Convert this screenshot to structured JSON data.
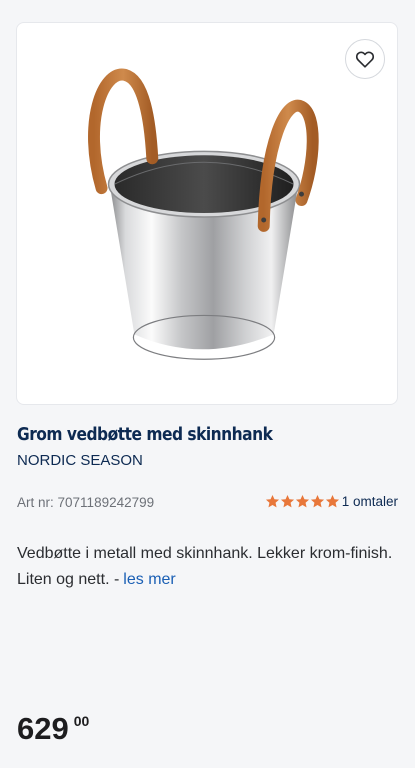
{
  "product": {
    "title": "Grom vedbøtte med skinnhank",
    "brand": "NORDIC SEASON",
    "image_alt": "vedbøtte",
    "favorite_icon": "heart-outline-icon"
  },
  "meta": {
    "art_label": "Art nr:",
    "art_number": "7071189242799",
    "rating_stars": 5,
    "rating_max": 5,
    "rating_text": "1 omtaler",
    "star_color": "#e8773a"
  },
  "description": {
    "text": "Vedbøtte i metall med skinnhank. Lekker krom-finish. Liten og nett. -",
    "read_more": "les mer"
  },
  "price": {
    "main": "629",
    "cents": "00"
  }
}
